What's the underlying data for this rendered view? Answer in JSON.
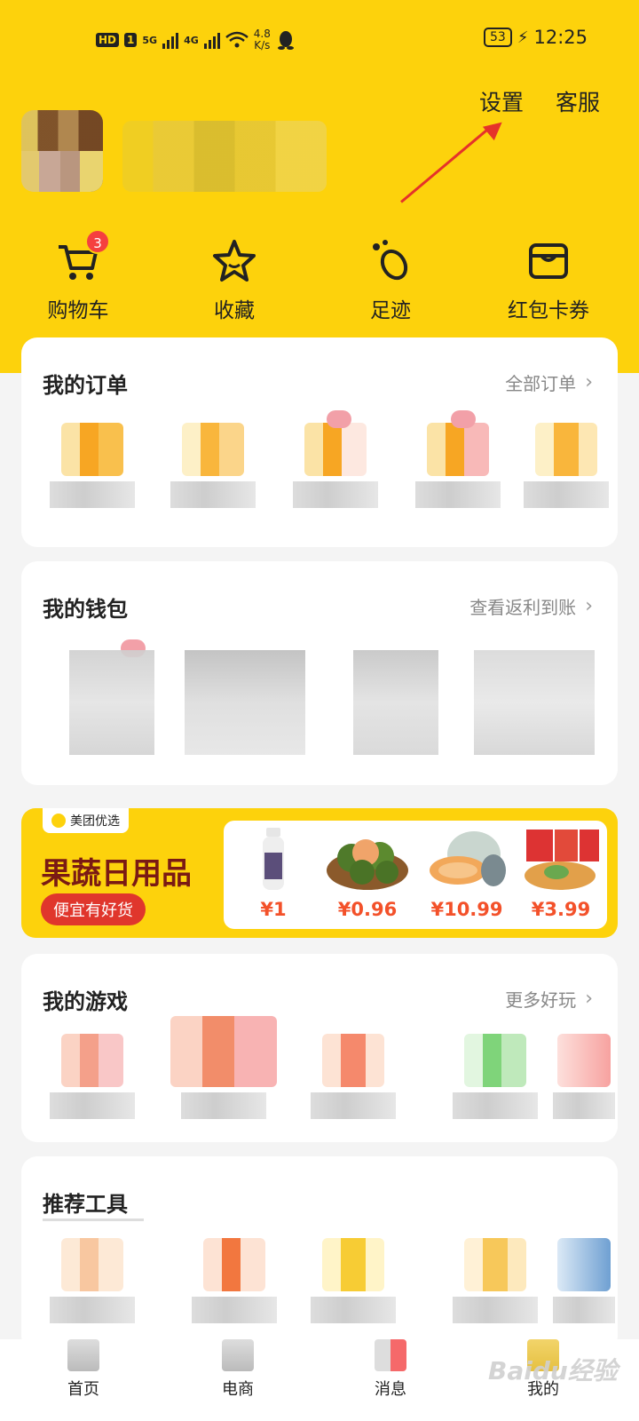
{
  "status_bar": {
    "hd": "HD",
    "sim": "1",
    "net1": "5G",
    "net2": "4G",
    "speed_value": "4.8",
    "speed_unit": "K/s",
    "battery": "53",
    "time": "12:25"
  },
  "header": {
    "settings_label": "设置",
    "service_label": "客服"
  },
  "quick_actions": [
    {
      "label": "购物车",
      "badge": "3",
      "icon": "cart-icon"
    },
    {
      "label": "收藏",
      "icon": "star-icon"
    },
    {
      "label": "足迹",
      "icon": "footprint-icon"
    },
    {
      "label": "红包卡券",
      "icon": "coupon-wallet-icon"
    }
  ],
  "orders": {
    "title": "我的订单",
    "link": "全部订单"
  },
  "wallet": {
    "title": "我的钱包",
    "link": "查看返利到账"
  },
  "banner": {
    "tag": "美团优选",
    "title": "果蔬日用品",
    "pill": "便宜有好货",
    "products": [
      {
        "price": "¥1",
        "icon": "milk-bottle"
      },
      {
        "price": "¥0.96",
        "icon": "oranges"
      },
      {
        "price": "¥10.99",
        "icon": "melon"
      },
      {
        "price": "¥3.99",
        "icon": "noodle-pack"
      }
    ]
  },
  "games": {
    "title": "我的游戏",
    "link": "更多好玩"
  },
  "tools": {
    "title": "推荐工具"
  },
  "bottom_nav": [
    {
      "label": "首页"
    },
    {
      "label": "电商"
    },
    {
      "label": "消息"
    },
    {
      "label": "我的"
    }
  ],
  "watermark": "Baidu经验",
  "colors": {
    "brand_yellow": "#fdd20c",
    "accent_red": "#f5403f",
    "price_orange": "#f3512a"
  }
}
